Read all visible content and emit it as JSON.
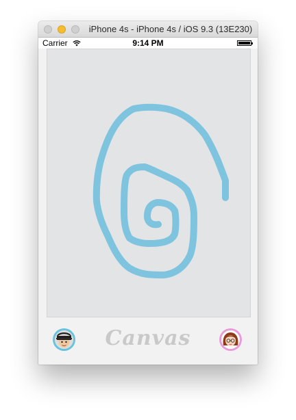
{
  "window": {
    "title": "iPhone 4s - iPhone 4s / iOS 9.3 (13E230)"
  },
  "status_bar": {
    "carrier": "Carrier",
    "time": "9:14 PM"
  },
  "canvas": {
    "stroke_color": "#7fc4de",
    "background": "#e3e4e6"
  },
  "bottom_bar": {
    "logo_text": "Canvas",
    "left_avatar": "boy-avatar",
    "right_avatar": "girl-avatar"
  }
}
